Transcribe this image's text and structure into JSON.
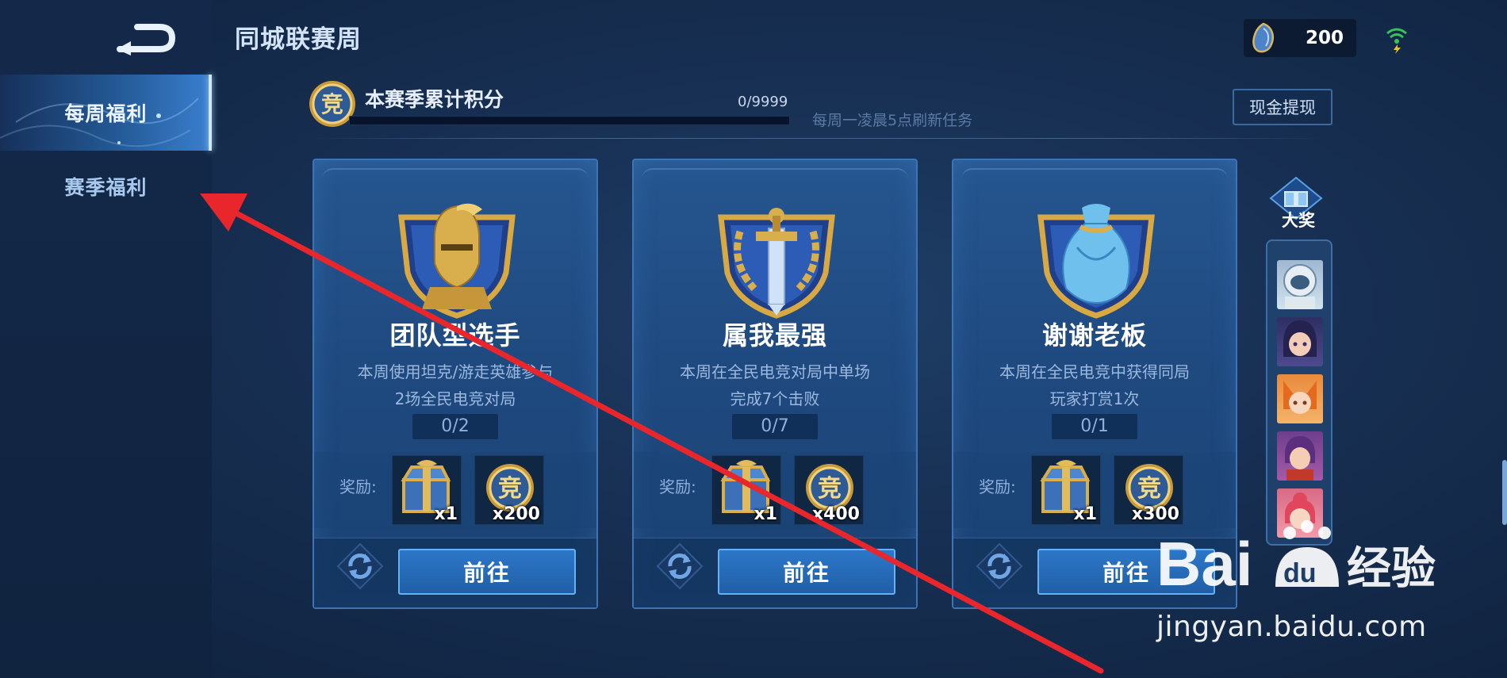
{
  "app": {
    "title": "同城联赛周",
    "currency": {
      "icon": "gem-icon",
      "value": "200"
    }
  },
  "sidebar": {
    "back_icon": "back-arrow-icon",
    "items": [
      {
        "label": "每周福利",
        "active": true
      },
      {
        "label": "赛季福利",
        "active": false
      }
    ]
  },
  "season_points": {
    "label": "本赛季累计积分",
    "count": "0/9999",
    "progress_fraction": 0,
    "refresh_note": "每周一凌晨5点刷新任务",
    "cash_button": "现金提现"
  },
  "tasks": [
    {
      "title": "团队型选手",
      "desc_line1": "本周使用坦克/游走英雄参与",
      "desc_line2": "2场全民电竞对局",
      "progress": "0/2",
      "reward_label": "奖励:",
      "rewards": [
        {
          "icon": "chest-icon",
          "qty": "x1"
        },
        {
          "icon": "jing-coin-icon",
          "qty": "x200"
        }
      ],
      "go_label": "前往"
    },
    {
      "title": "属我最强",
      "desc_line1": "本周在全民电竞对局中单场",
      "desc_line2": "完成7个击败",
      "progress": "0/7",
      "reward_label": "奖励:",
      "rewards": [
        {
          "icon": "chest-icon",
          "qty": "x1"
        },
        {
          "icon": "jing-coin-icon",
          "qty": "x400"
        }
      ],
      "go_label": "前往"
    },
    {
      "title": "谢谢老板",
      "desc_line1": "本周在全民电竞中获得同局",
      "desc_line2": "玩家打赏1次",
      "progress": "0/1",
      "reward_label": "奖励:",
      "rewards": [
        {
          "icon": "chest-icon",
          "qty": "x1"
        },
        {
          "icon": "jing-coin-icon",
          "qty": "x300"
        }
      ],
      "go_label": "前往"
    }
  ],
  "prize_rail": {
    "grand_label": "大奖",
    "avatars": [
      "astronaut-avatar",
      "dark-haired-hero-avatar",
      "fox-hero-avatar",
      "purple-hero-avatar",
      "pink-hero-avatar"
    ]
  },
  "watermark": {
    "logo_text": "Bai du 经验",
    "url": "jingyan.baidu.com"
  },
  "colors": {
    "accent": "#3f9bff",
    "card_bg": "#22528a",
    "annotation_arrow": "#e8262b",
    "gold": "#d8a842"
  }
}
